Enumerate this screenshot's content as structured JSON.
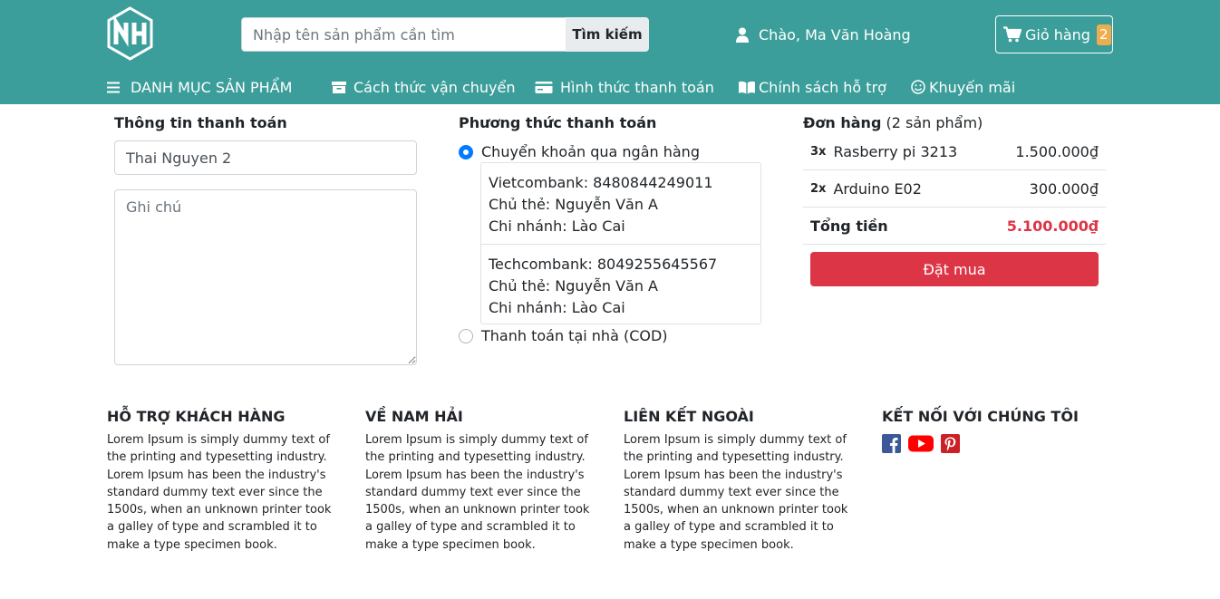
{
  "header": {
    "logo_text": "NH",
    "search": {
      "placeholder": "Nhập tên sản phẩm cần tìm",
      "button_label": "Tìm kiếm"
    },
    "greeting": "Chào, Ma Văn Hoàng",
    "cart": {
      "label": "Giỏ hàng",
      "count": "2"
    }
  },
  "nav": {
    "menu_label": "DANH MỤC SẢN PHẨM",
    "links": [
      {
        "label": "Cách thức vận chuyển",
        "icon": "archive-icon"
      },
      {
        "label": "Hình thức thanh toán",
        "icon": "credit-card-icon"
      },
      {
        "label": "Chính sách hỗ trợ",
        "icon": "book-icon"
      },
      {
        "label": "Khuyến mãi",
        "icon": "smile-icon"
      }
    ]
  },
  "billing": {
    "title": "Thông tin thanh toán",
    "address_value": "Thai Nguyen 2",
    "note_placeholder": "Ghi chú"
  },
  "payment": {
    "title": "Phương thức thanh toán",
    "options": [
      {
        "label": "Chuyển khoản qua ngân hàng",
        "selected": true
      },
      {
        "label": "Thanh toán tại nhà (COD)",
        "selected": false
      }
    ],
    "banks": [
      {
        "line1": "Vietcombank: 8480844249011",
        "line2": "Chủ thẻ: Nguyễn Văn A",
        "line3": "Chi nhánh: Lào Cai"
      },
      {
        "line1": "Techcombank: 8049255645567",
        "line2": "Chủ thẻ: Nguyễn Văn A",
        "line3": "Chi nhánh: Lào Cai"
      }
    ]
  },
  "order": {
    "title": "Đơn hàng",
    "count_text": "(2 sản phẩm)",
    "items": [
      {
        "qty": "3x",
        "name": "Rasberry pi 3213",
        "price": "1.500.000₫"
      },
      {
        "qty": "2x",
        "name": "Arduino E02",
        "price": "300.000₫"
      }
    ],
    "total_label": "Tổng tiền",
    "total_value": "5.100.000₫",
    "button_label": "Đặt mua"
  },
  "footer": {
    "lorem": "Lorem Ipsum is simply dummy text of the printing and typesetting industry. Lorem Ipsum has been the industry's standard dummy text ever since the 1500s, when an unknown printer took a galley of type and scrambled it to make a type specimen book.",
    "columns": [
      {
        "title": "HỖ TRỢ KHÁCH HÀNG"
      },
      {
        "title": "VỀ NAM HẢI"
      },
      {
        "title": "LIÊN KẾT NGOÀI"
      },
      {
        "title": "KẾT NỐI VỚI CHÚNG TÔI"
      }
    ],
    "social": [
      "facebook-icon",
      "youtube-icon",
      "pinterest-icon"
    ]
  },
  "colors": {
    "header_bg": "#3b9e9a",
    "accent_red": "#dc3545",
    "badge": "#f0ad4e",
    "radio_checked": "#007bff"
  }
}
